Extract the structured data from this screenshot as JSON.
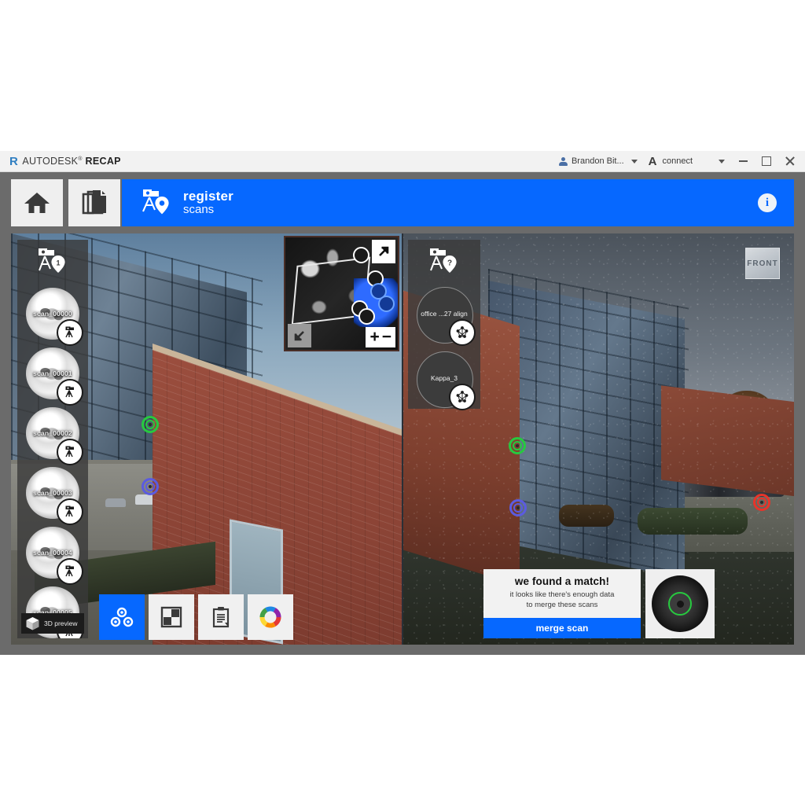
{
  "window": {
    "title_brand": "AUTODESK",
    "title_brand_sup": "®",
    "title_product": "RECAP",
    "logo_mark": "R",
    "user": {
      "name": "Brandon Bit...",
      "icon": "user-icon",
      "caret": "chevron-down-icon"
    },
    "connect": {
      "label": "connect",
      "mark": "A",
      "caret": "chevron-down-icon"
    },
    "controls": {
      "minimize": "minimize-icon",
      "maximize": "maximize-icon",
      "close": "close-icon"
    }
  },
  "nav": {
    "home_icon": "home-icon",
    "projects_icon": "documents-stack-icon",
    "banner": {
      "icon": "scan-station-icon",
      "title": "register",
      "subtitle": "scans",
      "info_icon": "info-icon",
      "info_glyph": "i",
      "color": "#0668ff"
    }
  },
  "left_viewport": {
    "rail": {
      "header_icon": "scan-station-icon",
      "header_badge": "1",
      "scans": [
        {
          "label": "scan_00000",
          "badge_icon": "tripod-scanner-icon"
        },
        {
          "label": "scan_00001",
          "badge_icon": "tripod-scanner-icon"
        },
        {
          "label": "scan_00002",
          "badge_icon": "tripod-scanner-icon"
        },
        {
          "label": "scan_00003",
          "badge_icon": "tripod-scanner-icon"
        },
        {
          "label": "scan_00004",
          "badge_icon": "tripod-scanner-icon"
        },
        {
          "label": "scan_00005",
          "badge_icon": "tripod-scanner-icon"
        }
      ],
      "preview_button": {
        "label": "3D preview",
        "icon": "cube-icon"
      }
    },
    "minimap": {
      "expand_icon": "arrow-expand-icon",
      "collapse_icon": "arrow-collapse-icon",
      "zoom_in": "+",
      "zoom_out": "−"
    },
    "targets": [
      {
        "name": "target-green",
        "color": "#27c93f"
      },
      {
        "name": "target-blue",
        "color": "#5b5be0"
      }
    ],
    "toolbar": [
      {
        "name": "targets-tool",
        "icon": "three-circles-icon",
        "active": true
      },
      {
        "name": "checkerboard-tool",
        "icon": "checkerboard-icon",
        "active": false
      },
      {
        "name": "notes-tool",
        "icon": "clipboard-icon",
        "active": false
      },
      {
        "name": "color-tool",
        "icon": "color-wheel-icon",
        "active": false
      }
    ]
  },
  "right_viewport": {
    "rail": {
      "header_icon": "scan-station-icon",
      "header_badge": "?",
      "groups": [
        {
          "label": "office ...27 align",
          "badge_icon": "point-cloud-icon"
        },
        {
          "label": "Kappa_3",
          "badge_icon": "point-cloud-icon"
        }
      ]
    },
    "viewcube": {
      "label": "FRONT"
    },
    "targets": [
      {
        "name": "target-green",
        "color": "#27c93f"
      },
      {
        "name": "target-blue",
        "color": "#5b5be0"
      },
      {
        "name": "target-red",
        "color": "#e8342a"
      }
    ],
    "match_dialog": {
      "title": "we found a match!",
      "line1": "it looks like there's enough data",
      "line2": "to merge these scans",
      "button": "merge scan",
      "button_color": "#0668ff"
    },
    "nav_wheel": {
      "icon": "navigation-wheel-icon",
      "ring_color": "#27c93f"
    }
  }
}
